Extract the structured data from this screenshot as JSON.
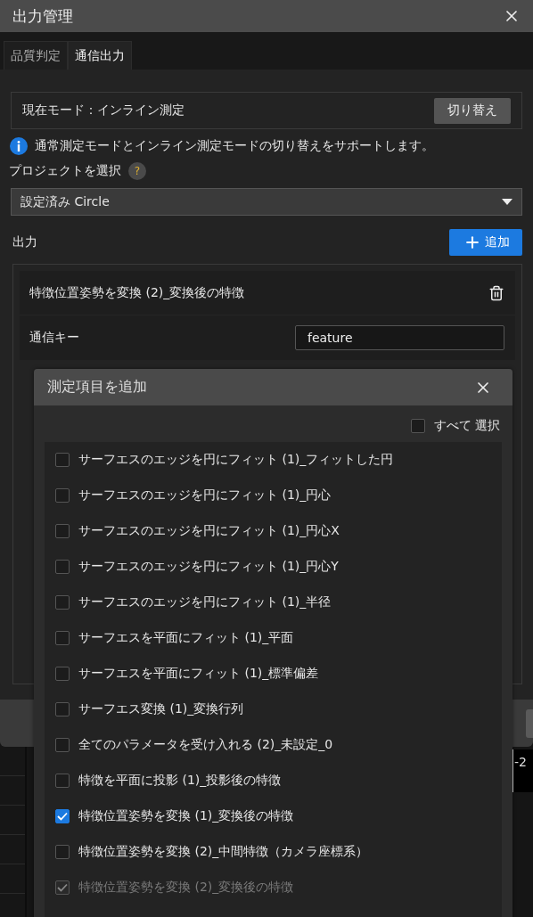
{
  "window": {
    "title": "出力管理"
  },
  "tabs": [
    {
      "label": "品質判定",
      "selected": false
    },
    {
      "label": "通信出力",
      "selected": true
    }
  ],
  "mode": {
    "text": "現在モード：インライン測定",
    "button": "切り替え"
  },
  "info": "通常測定モードとインライン測定モードの切り替えをサポートします。",
  "project": {
    "label": "プロジェクトを選択",
    "help": "?",
    "value": "設定済み Circle"
  },
  "output": {
    "label": "出力",
    "add_button": "追加",
    "items": [
      {
        "title": "特徴位置姿勢を変換 (2)_変換後の特徴",
        "key_label": "通信キー",
        "key_value": "feature"
      }
    ]
  },
  "add_dialog": {
    "title": "測定項目を追加",
    "select_all": {
      "label": "すべて 選択",
      "checked": false
    },
    "items": [
      {
        "label": "サーフエスのエッジを円にフィット (1)_フィットした円",
        "checked": false,
        "disabled": false
      },
      {
        "label": "サーフエスのエッジを円にフィット (1)_円心",
        "checked": false,
        "disabled": false
      },
      {
        "label": "サーフエスのエッジを円にフィット (1)_円心X",
        "checked": false,
        "disabled": false
      },
      {
        "label": "サーフエスのエッジを円にフィット (1)_円心Y",
        "checked": false,
        "disabled": false
      },
      {
        "label": "サーフエスのエッジを円にフィット (1)_半径",
        "checked": false,
        "disabled": false
      },
      {
        "label": "サーフエスを平面にフィット (1)_平面",
        "checked": false,
        "disabled": false
      },
      {
        "label": "サーフエスを平面にフィット (1)_標準偏差",
        "checked": false,
        "disabled": false
      },
      {
        "label": "サーフエス変換 (1)_変換行列",
        "checked": false,
        "disabled": false
      },
      {
        "label": "全てのパラメータを受け入れる (2)_未設定_0",
        "checked": false,
        "disabled": false
      },
      {
        "label": "特徴を平面に投影 (1)_投影後の特徴",
        "checked": false,
        "disabled": false
      },
      {
        "label": "特徴位置姿勢を変換 (1)_変換後の特徴",
        "checked": true,
        "disabled": false
      },
      {
        "label": "特徴位置姿勢を変換 (2)_中間特徴（カメラ座標系）",
        "checked": false,
        "disabled": false
      },
      {
        "label": "特徴位置姿勢を変換 (2)_変換後の特徴",
        "checked": true,
        "disabled": true
      }
    ]
  },
  "background": {
    "reading": "-2"
  }
}
